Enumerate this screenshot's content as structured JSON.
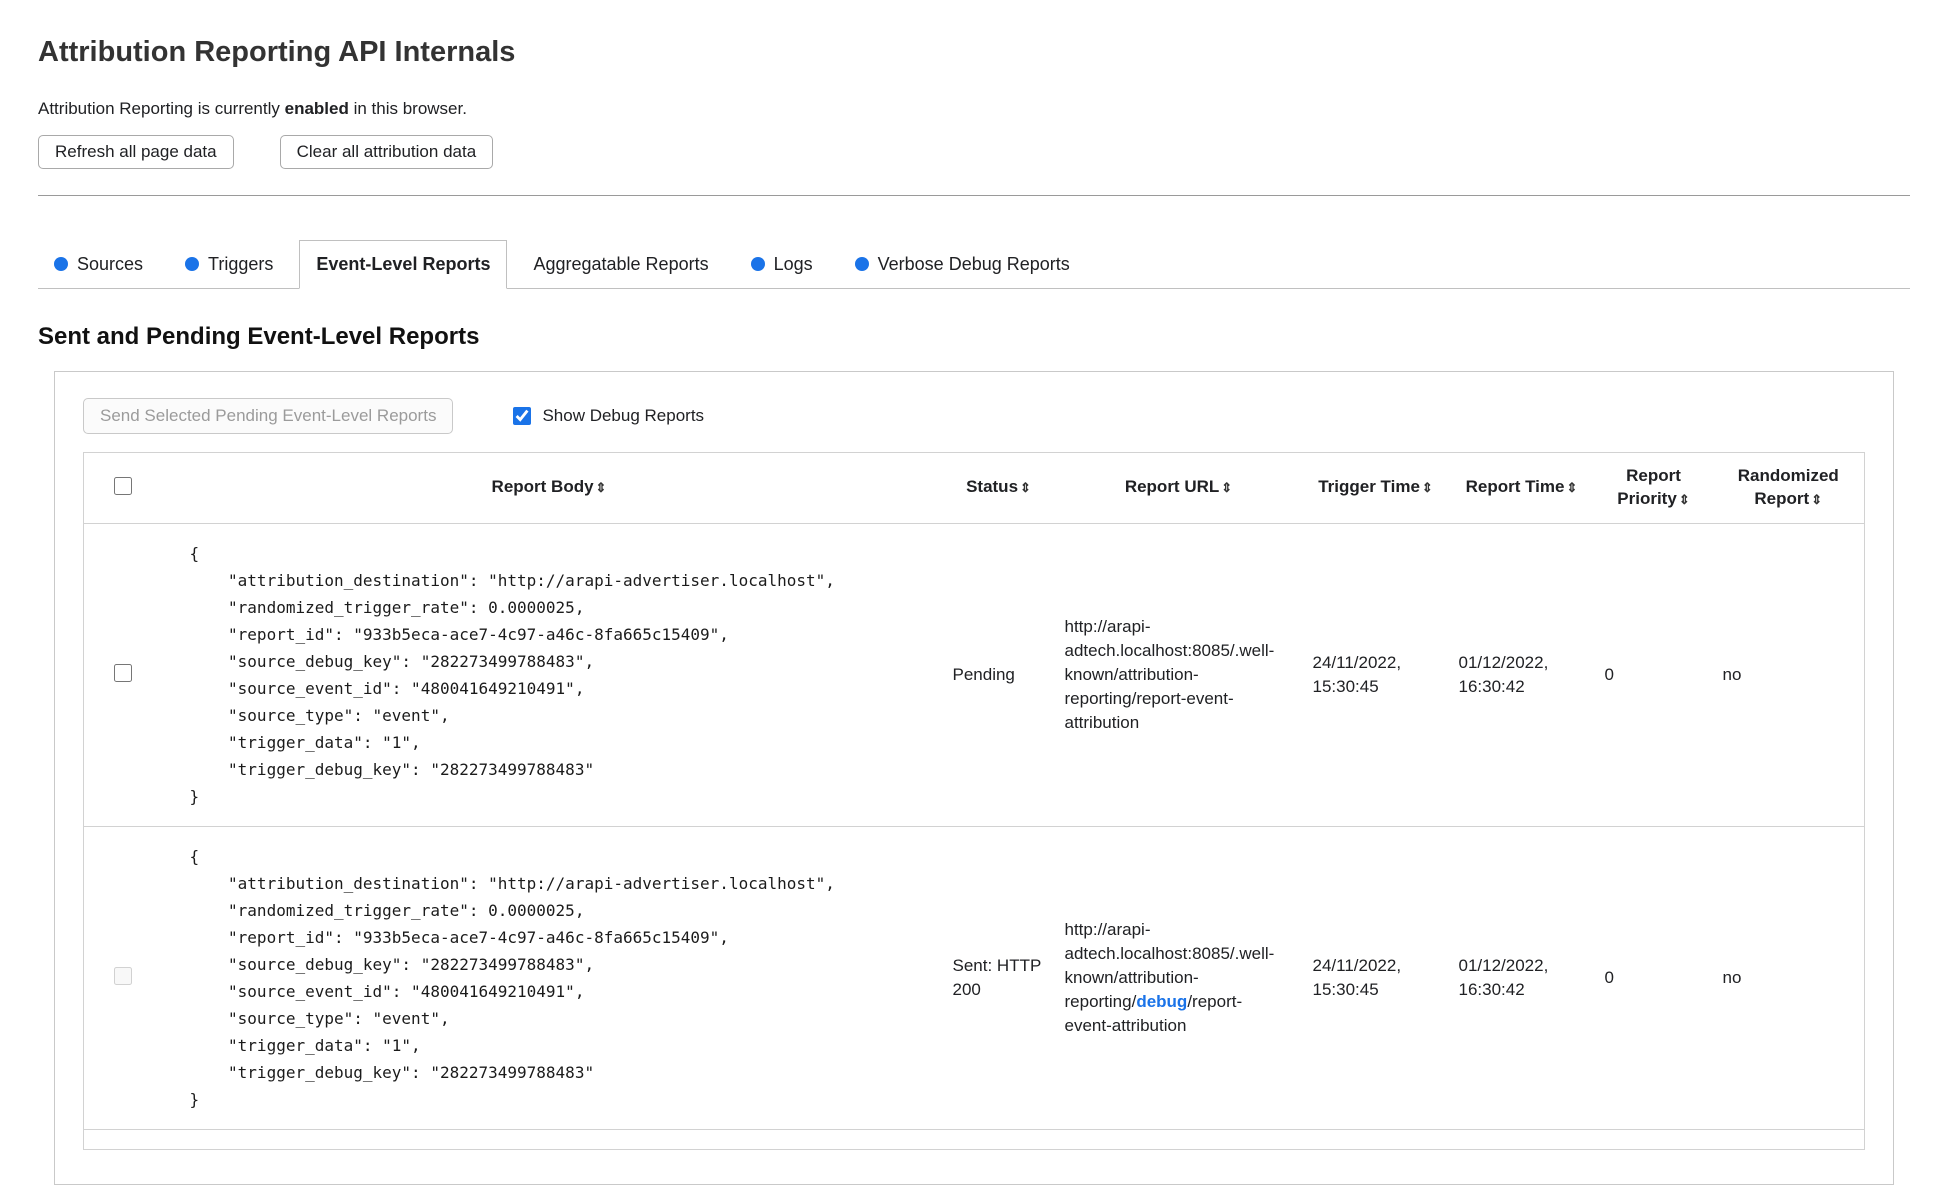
{
  "colors": {
    "accent_blue": "#1a73e8",
    "border_gray": "#c9c9c9"
  },
  "header": {
    "title": "Attribution Reporting API Internals",
    "status": {
      "prefix": "Attribution Reporting is currently ",
      "emphasis": "enabled",
      "suffix": " in this browser."
    },
    "buttons": {
      "refresh": "Refresh all page data",
      "clear": "Clear all attribution data"
    }
  },
  "tabs": {
    "items": [
      {
        "label": "Sources"
      },
      {
        "label": "Triggers"
      },
      {
        "label": "Event-Level Reports"
      },
      {
        "label": "Aggregatable Reports"
      },
      {
        "label": "Logs"
      },
      {
        "label": "Verbose Debug Reports"
      }
    ]
  },
  "reports_section": {
    "heading": "Sent and Pending Event-Level Reports",
    "send_button": "Send Selected Pending Event-Level Reports",
    "show_debug_label": "Show Debug Reports",
    "show_debug_checked": "checked"
  },
  "table": {
    "sort_glyph": "⇕",
    "headers": {
      "report_body": "Report Body",
      "status": "Status",
      "report_url": "Report URL",
      "trigger_time": "Trigger Time",
      "report_time": "Report Time",
      "report_priority": "Report Priority",
      "randomized_report": "Randomized Report"
    },
    "rows": [
      {
        "report_body": "{\n    \"attribution_destination\": \"http://arapi-advertiser.localhost\",\n    \"randomized_trigger_rate\": 0.0000025,\n    \"report_id\": \"933b5eca-ace7-4c97-a46c-8fa665c15409\",\n    \"source_debug_key\": \"282273499788483\",\n    \"source_event_id\": \"480041649210491\",\n    \"source_type\": \"event\",\n    \"trigger_data\": \"1\",\n    \"trigger_debug_key\": \"282273499788483\"\n}",
        "status": "Pending",
        "url_prefix": "http://arapi-adtech.localhost:8085/.well-known/attribution-reporting/report-event-attribution",
        "url_debug": "",
        "url_suffix": "",
        "trigger_time": "24/11/2022, 15:30:45",
        "report_time": "01/12/2022, 16:30:42",
        "report_priority": "0",
        "randomized_report": "no"
      },
      {
        "report_body": "{\n    \"attribution_destination\": \"http://arapi-advertiser.localhost\",\n    \"randomized_trigger_rate\": 0.0000025,\n    \"report_id\": \"933b5eca-ace7-4c97-a46c-8fa665c15409\",\n    \"source_debug_key\": \"282273499788483\",\n    \"source_event_id\": \"480041649210491\",\n    \"source_type\": \"event\",\n    \"trigger_data\": \"1\",\n    \"trigger_debug_key\": \"282273499788483\"\n}",
        "status": "Sent: HTTP 200",
        "url_prefix": "http://arapi-adtech.localhost:8085/.well-known/attribution-reporting/",
        "url_debug": "debug",
        "url_suffix": "/report-event-attribution",
        "trigger_time": "24/11/2022, 15:30:45",
        "report_time": "01/12/2022, 16:30:42",
        "report_priority": "0",
        "randomized_report": "no",
        "checkbox_disabled": "disabled"
      }
    ]
  }
}
